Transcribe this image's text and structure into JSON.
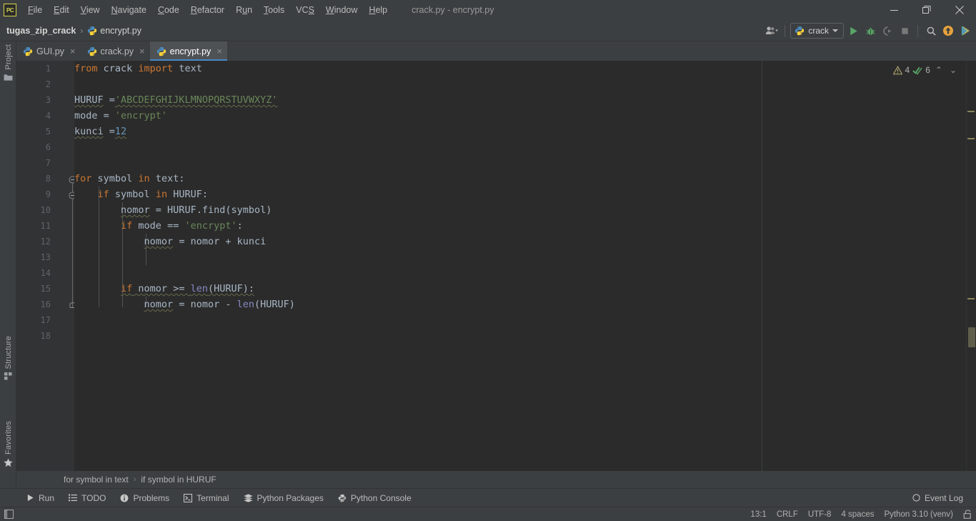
{
  "window": {
    "title": "crack.py - encrypt.py",
    "controls": {
      "minimize": "minimize-icon",
      "maximize": "restore-icon",
      "close": "close-icon"
    }
  },
  "menubar": {
    "items": [
      {
        "label": "File",
        "mnemonic": "F"
      },
      {
        "label": "Edit",
        "mnemonic": "E"
      },
      {
        "label": "View",
        "mnemonic": "V"
      },
      {
        "label": "Navigate",
        "mnemonic": "N"
      },
      {
        "label": "Code",
        "mnemonic": "C"
      },
      {
        "label": "Refactor",
        "mnemonic": "R"
      },
      {
        "label": "Run",
        "mnemonic": "u"
      },
      {
        "label": "Tools",
        "mnemonic": "T"
      },
      {
        "label": "VCS",
        "mnemonic": "S"
      },
      {
        "label": "Window",
        "mnemonic": "W"
      },
      {
        "label": "Help",
        "mnemonic": "H"
      }
    ]
  },
  "navbar": {
    "breadcrumb": [
      {
        "label": "tugas_zip_crack",
        "icon": null
      },
      {
        "label": "encrypt.py",
        "icon": "python-file-icon"
      }
    ],
    "separator": "›"
  },
  "toolbar": {
    "account_icon": "user-account-icon",
    "run_config": {
      "label": "crack",
      "icon": "python-file-icon"
    },
    "buttons": [
      {
        "name": "run-button",
        "icon": "run-triangle-icon"
      },
      {
        "name": "debug-button",
        "icon": "debug-bug-icon"
      },
      {
        "name": "run-coverage-button",
        "icon": "coverage-icon"
      },
      {
        "name": "stop-button",
        "icon": "stop-square-icon"
      },
      {
        "name": "search-everywhere-button",
        "icon": "search-icon"
      },
      {
        "name": "update-project-button",
        "icon": "update-arrow-icon"
      },
      {
        "name": "ide-assistant-button",
        "icon": "assistant-icon"
      }
    ]
  },
  "left_tool_strip": {
    "project": "Project",
    "structure": "Structure",
    "favorites": "Favorites"
  },
  "tabs": [
    {
      "label": "GUI.py",
      "icon": "python-file-icon",
      "active": false
    },
    {
      "label": "crack.py",
      "icon": "python-file-icon",
      "active": false
    },
    {
      "label": "encrypt.py",
      "icon": "python-file-icon",
      "active": true
    }
  ],
  "tab_close_glyph": "×",
  "inspections": {
    "warning_count": "4",
    "warning_icon": "warning-triangle-icon",
    "ok_count": "6",
    "ok_icon": "inspection-check-icon",
    "prev_glyph": "⌃",
    "next_glyph": "⌄"
  },
  "editor": {
    "line_numbers": [
      "1",
      "2",
      "3",
      "4",
      "5",
      "6",
      "7",
      "8",
      "9",
      "10",
      "11",
      "12",
      "13",
      "14",
      "15",
      "16",
      "17",
      "18"
    ],
    "current_line": 13,
    "code_lines": [
      {
        "n": 1,
        "text": "from crack import text"
      },
      {
        "n": 2,
        "text": ""
      },
      {
        "n": 3,
        "text": "HURUF ='ABCDEFGHIJKLMNOPQRSTUVWXYZ'"
      },
      {
        "n": 4,
        "text": "mode = 'encrypt'"
      },
      {
        "n": 5,
        "text": "kunci =12"
      },
      {
        "n": 6,
        "text": ""
      },
      {
        "n": 7,
        "text": ""
      },
      {
        "n": 8,
        "text": "for symbol in text:"
      },
      {
        "n": 9,
        "text": "    if symbol in HURUF:"
      },
      {
        "n": 10,
        "text": "        nomor = HURUF.find(symbol)"
      },
      {
        "n": 11,
        "text": "        if mode == 'encrypt':"
      },
      {
        "n": 12,
        "text": "            nomor = nomor + kunci"
      },
      {
        "n": 13,
        "text": ""
      },
      {
        "n": 14,
        "text": ""
      },
      {
        "n": 15,
        "text": "        if nomor >= len(HURUF):"
      },
      {
        "n": 16,
        "text": "            nomor = nomor - len(HURUF)"
      },
      {
        "n": 17,
        "text": ""
      },
      {
        "n": 18,
        "text": ""
      }
    ],
    "colors": {
      "background": "#2b2b2b",
      "gutter": "#313335",
      "keyword": "#cc7832",
      "string": "#6a8759",
      "number": "#6897bb",
      "builtin": "#8888c6",
      "text": "#a9b7c6",
      "line_number": "#606366",
      "current_line": "#323232",
      "warning_marker": "#8a8458"
    }
  },
  "editor_breadcrumb": {
    "segments": [
      "for symbol in text",
      "if symbol in HURUF"
    ],
    "separator": "›"
  },
  "bottom_tool_windows": [
    {
      "label": "Run",
      "icon": "run-triangle-icon"
    },
    {
      "label": "TODO",
      "icon": "todo-list-icon"
    },
    {
      "label": "Problems",
      "icon": "problems-icon"
    },
    {
      "label": "Terminal",
      "icon": "terminal-icon"
    },
    {
      "label": "Python Packages",
      "icon": "packages-icon"
    },
    {
      "label": "Python Console",
      "icon": "python-console-icon"
    }
  ],
  "event_log": {
    "label": "Event Log",
    "icon": "event-log-icon"
  },
  "statusbar": {
    "hide_icon": "hide-windows-icon",
    "caret_position": "13:1",
    "line_separator": "CRLF",
    "encoding": "UTF-8",
    "indent": "4 spaces",
    "interpreter": "Python 3.10 (venv)",
    "lock_icon": "unlocked-icon"
  }
}
